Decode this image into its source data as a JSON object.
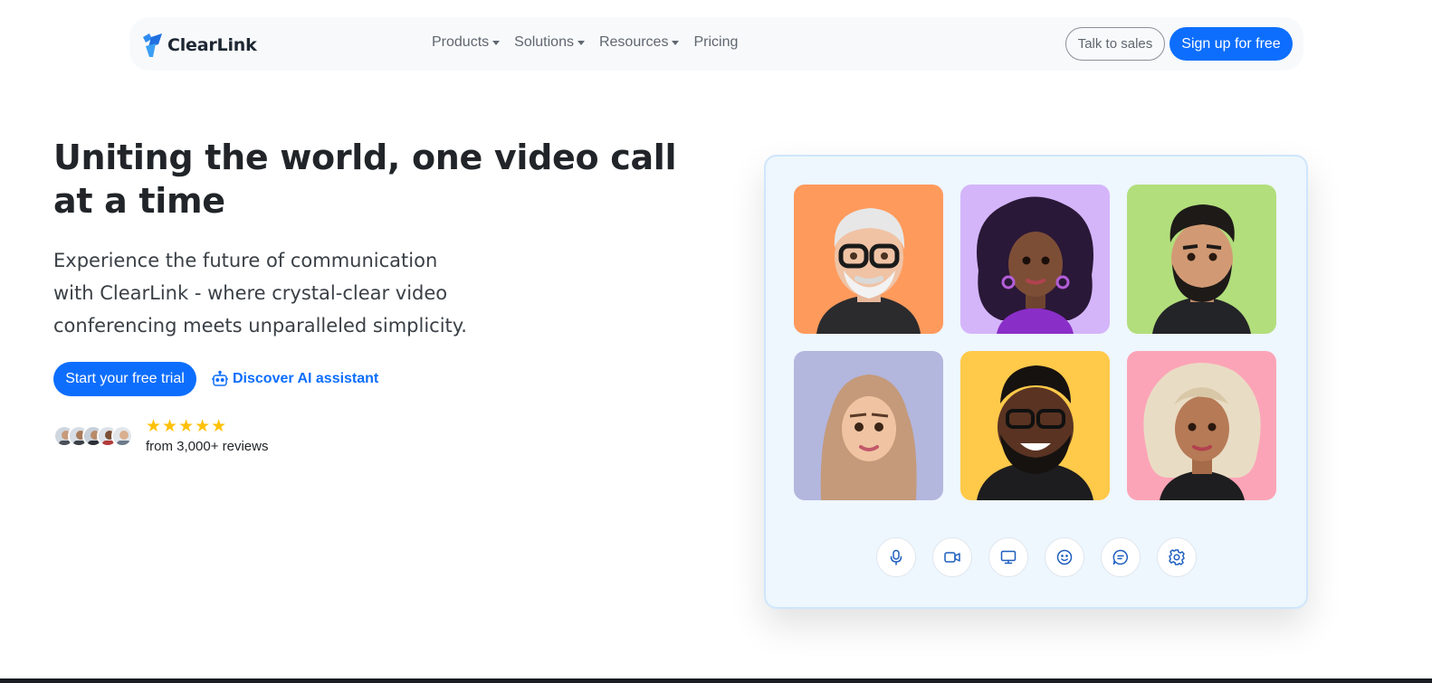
{
  "nav": {
    "brand": "ClearLink",
    "menu": [
      {
        "label": "Products",
        "dropdown": true
      },
      {
        "label": "Solutions",
        "dropdown": true
      },
      {
        "label": "Resources",
        "dropdown": true
      },
      {
        "label": "Pricing",
        "dropdown": false
      }
    ],
    "talk_to_sales": "Talk to sales",
    "sign_up": "Sign up for free"
  },
  "hero": {
    "title": "Uniting the world, one video call at a time",
    "subtitle": "Experience the future of communication with ClearLink - where crystal-clear video conferencing meets unparalleled simplicity.",
    "cta_primary": "Start your free trial",
    "cta_secondary": "Discover AI assistant",
    "cta_secondary_icon": "robot-icon",
    "rating_stars": "★★★★★",
    "rating_value": 5,
    "reviews_text": "from 3,000+ reviews"
  },
  "video_call": {
    "participants": [
      {
        "name": "participant-1",
        "bg": "#fe9a5c"
      },
      {
        "name": "participant-2",
        "bg": "#d4b5fa"
      },
      {
        "name": "participant-3",
        "bg": "#b2de7c"
      },
      {
        "name": "participant-4",
        "bg": "#b3b6dd"
      },
      {
        "name": "participant-5",
        "bg": "#ffc94a"
      },
      {
        "name": "participant-6",
        "bg": "#fca4b7"
      }
    ],
    "controls": [
      "microphone-icon",
      "camera-icon",
      "screen-share-icon",
      "emoji-icon",
      "chat-icon",
      "settings-icon"
    ]
  },
  "colors": {
    "primary": "#0d6efd",
    "star": "#ffc107",
    "card_bg": "#eef6fe"
  }
}
